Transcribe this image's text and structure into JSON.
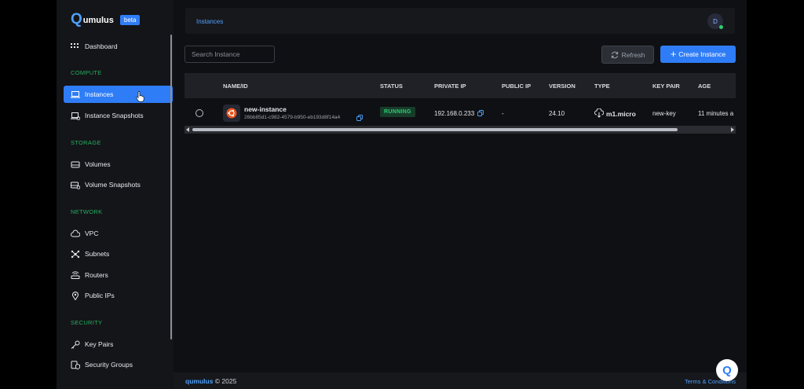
{
  "brand": {
    "logo_letter": "Q",
    "logo_text": "umulus",
    "badge": "beta"
  },
  "sidebar": {
    "dashboard": "Dashboard",
    "sections": {
      "compute": "COMPUTE",
      "storage": "STORAGE",
      "network": "NETWORK",
      "security": "SECURITY"
    },
    "items": {
      "instances": "Instances",
      "instance_snapshots": "Instance Snapshots",
      "volumes": "Volumes",
      "volume_snapshots": "Volume Snapshots",
      "vpc": "VPC",
      "subnets": "Subnets",
      "routers": "Routers",
      "public_ips": "Public IPs",
      "key_pairs": "Key Pairs",
      "security_groups": "Security Groups"
    },
    "active": "instances"
  },
  "header": {
    "breadcrumb": "Instances",
    "avatar_initial": "D"
  },
  "toolbar": {
    "search_placeholder": "Search Instance",
    "refresh_label": "Refresh",
    "create_label": "Create Instance"
  },
  "table": {
    "columns": [
      "NAME/ID",
      "STATUS",
      "PRIVATE IP",
      "PUBLIC IP",
      "VERSION",
      "TYPE",
      "KEY PAIR",
      "AGE"
    ],
    "rows": [
      {
        "name": "new-instance",
        "id": "26bb85d1-c982-4579-b950-eb193d8f14a4",
        "status": "RUNNING",
        "private_ip": "192.168.0.233",
        "public_ip": "-",
        "version": "24.10",
        "type": "m1.micro",
        "key_pair": "new-key",
        "age": "11 minutes a"
      }
    ]
  },
  "footer": {
    "brand": "qumulus",
    "copyright": "© 2025",
    "terms": "Terms & Conditions"
  },
  "help": {
    "label": "Q"
  },
  "colors": {
    "accent": "#2f7df6",
    "link": "#4ea1ff",
    "running": "#2ecc71",
    "section": "#27ae60"
  },
  "icons": {
    "dashboard": "grid-icon",
    "instances": "laptop-icon",
    "instance_snapshots": "laptop-snapshot-icon",
    "volumes": "drive-icon",
    "volume_snapshots": "drive-snapshot-icon",
    "vpc": "cloud-icon",
    "subnets": "network-nodes-icon",
    "routers": "router-icon",
    "public_ips": "location-pin-icon",
    "key_pairs": "key-icon",
    "security_groups": "shield-group-icon"
  }
}
